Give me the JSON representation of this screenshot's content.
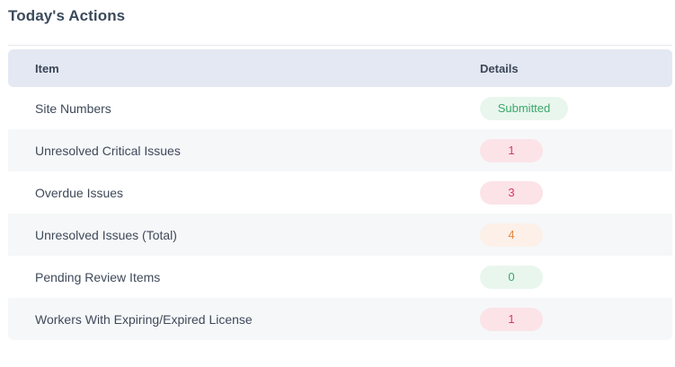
{
  "title": "Today's Actions",
  "columns": {
    "item": "Item",
    "details": "Details"
  },
  "rows": [
    {
      "item": "Site Numbers",
      "value": "Submitted",
      "status": "success"
    },
    {
      "item": "Unresolved Critical Issues",
      "value": "1",
      "status": "danger"
    },
    {
      "item": "Overdue Issues",
      "value": "3",
      "status": "danger"
    },
    {
      "item": "Unresolved Issues (Total)",
      "value": "4",
      "status": "warning"
    },
    {
      "item": "Pending Review Items",
      "value": "0",
      "status": "success"
    },
    {
      "item": "Workers With Expiring/Expired License",
      "value": "1",
      "status": "danger"
    }
  ],
  "colors": {
    "success_text": "#3ba76a",
    "danger_text": "#d9385a",
    "warning_text": "#e5863f",
    "header_bg": "#e3e8f3"
  }
}
